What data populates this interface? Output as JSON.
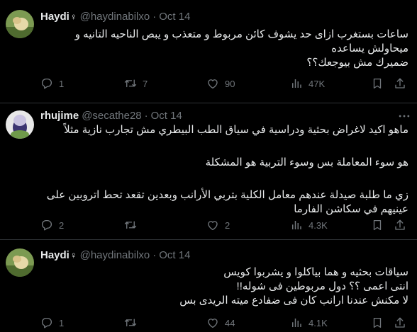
{
  "tweets": [
    {
      "author": "Haydi",
      "badge": "♀",
      "handle": "@haydinabilxo",
      "sep": "·",
      "date": "Oct 14",
      "text_lines": [
        "ساعات بستغرب ازاى حد يشوف كائن مربوط و متعذب و يبص الناحيه التانيه و ميحاولش يساعده",
        "ضميرك مش بيوجعك؟؟"
      ],
      "replies": "1",
      "retweets": "7",
      "likes": "90",
      "views": "47K"
    },
    {
      "author": "rhujime",
      "handle": "@secathe28",
      "sep": "·",
      "date": "Oct 14",
      "text_lines": [
        "ماهو اكيد لاغراض بحثية ودراسية في سياق الطب البيطري مش تجارب نازية مثلاً",
        "هو سوء المعاملة بس وسوء التربية هو المشكلة",
        "زي ما طلبة صيدلة عندهم معامل الكلية بتربي الأرانب وبعدين تقعد تحط اتروبين على عينيهم في سكاشن الفارما"
      ],
      "replies": "2",
      "retweets": "",
      "likes": "2",
      "views": "4.3K"
    },
    {
      "author": "Haydi",
      "badge": "♀",
      "handle": "@haydinabilxo",
      "sep": "·",
      "date": "Oct 14",
      "text_lines": [
        "سياقات بحثيه و هما بياكلوا و يشربوا كويس",
        "انتى اعمى ؟؟ دول مربوطين فى شوله!!",
        "لا مكنش عندنا ارانب كان فى ضفادع ميته الريدى بس"
      ],
      "replies": "1",
      "retweets": "",
      "likes": "44",
      "views": "4.1K"
    }
  ],
  "icons": [
    "reply-icon",
    "retweet-icon",
    "like-icon",
    "views-icon",
    "bookmark-icon",
    "share-icon",
    "more-icon"
  ],
  "colors": {
    "background": "#000000",
    "text": "#e7e9ea",
    "muted": "#71767b",
    "divider": "#2f3336"
  }
}
